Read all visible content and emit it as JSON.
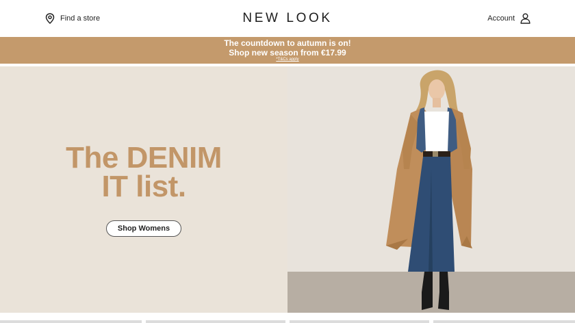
{
  "header": {
    "find_store_label": "Find a store",
    "logo_text": "NEW LOOK",
    "account_label": "Account"
  },
  "promo": {
    "line1": "The countdown to autumn is on!",
    "line2": "Shop new season from €17.99",
    "tcs": "*T&Cs apply",
    "background_color": "#c49a6c"
  },
  "hero": {
    "headline_line1": "The DENIM",
    "headline_line2": "IT list.",
    "cta_label": "Shop Womens",
    "headline_color": "#c29668",
    "panel_color": "#eae3d9"
  },
  "icons": {
    "store": "location-pin-icon",
    "account": "user-icon"
  }
}
